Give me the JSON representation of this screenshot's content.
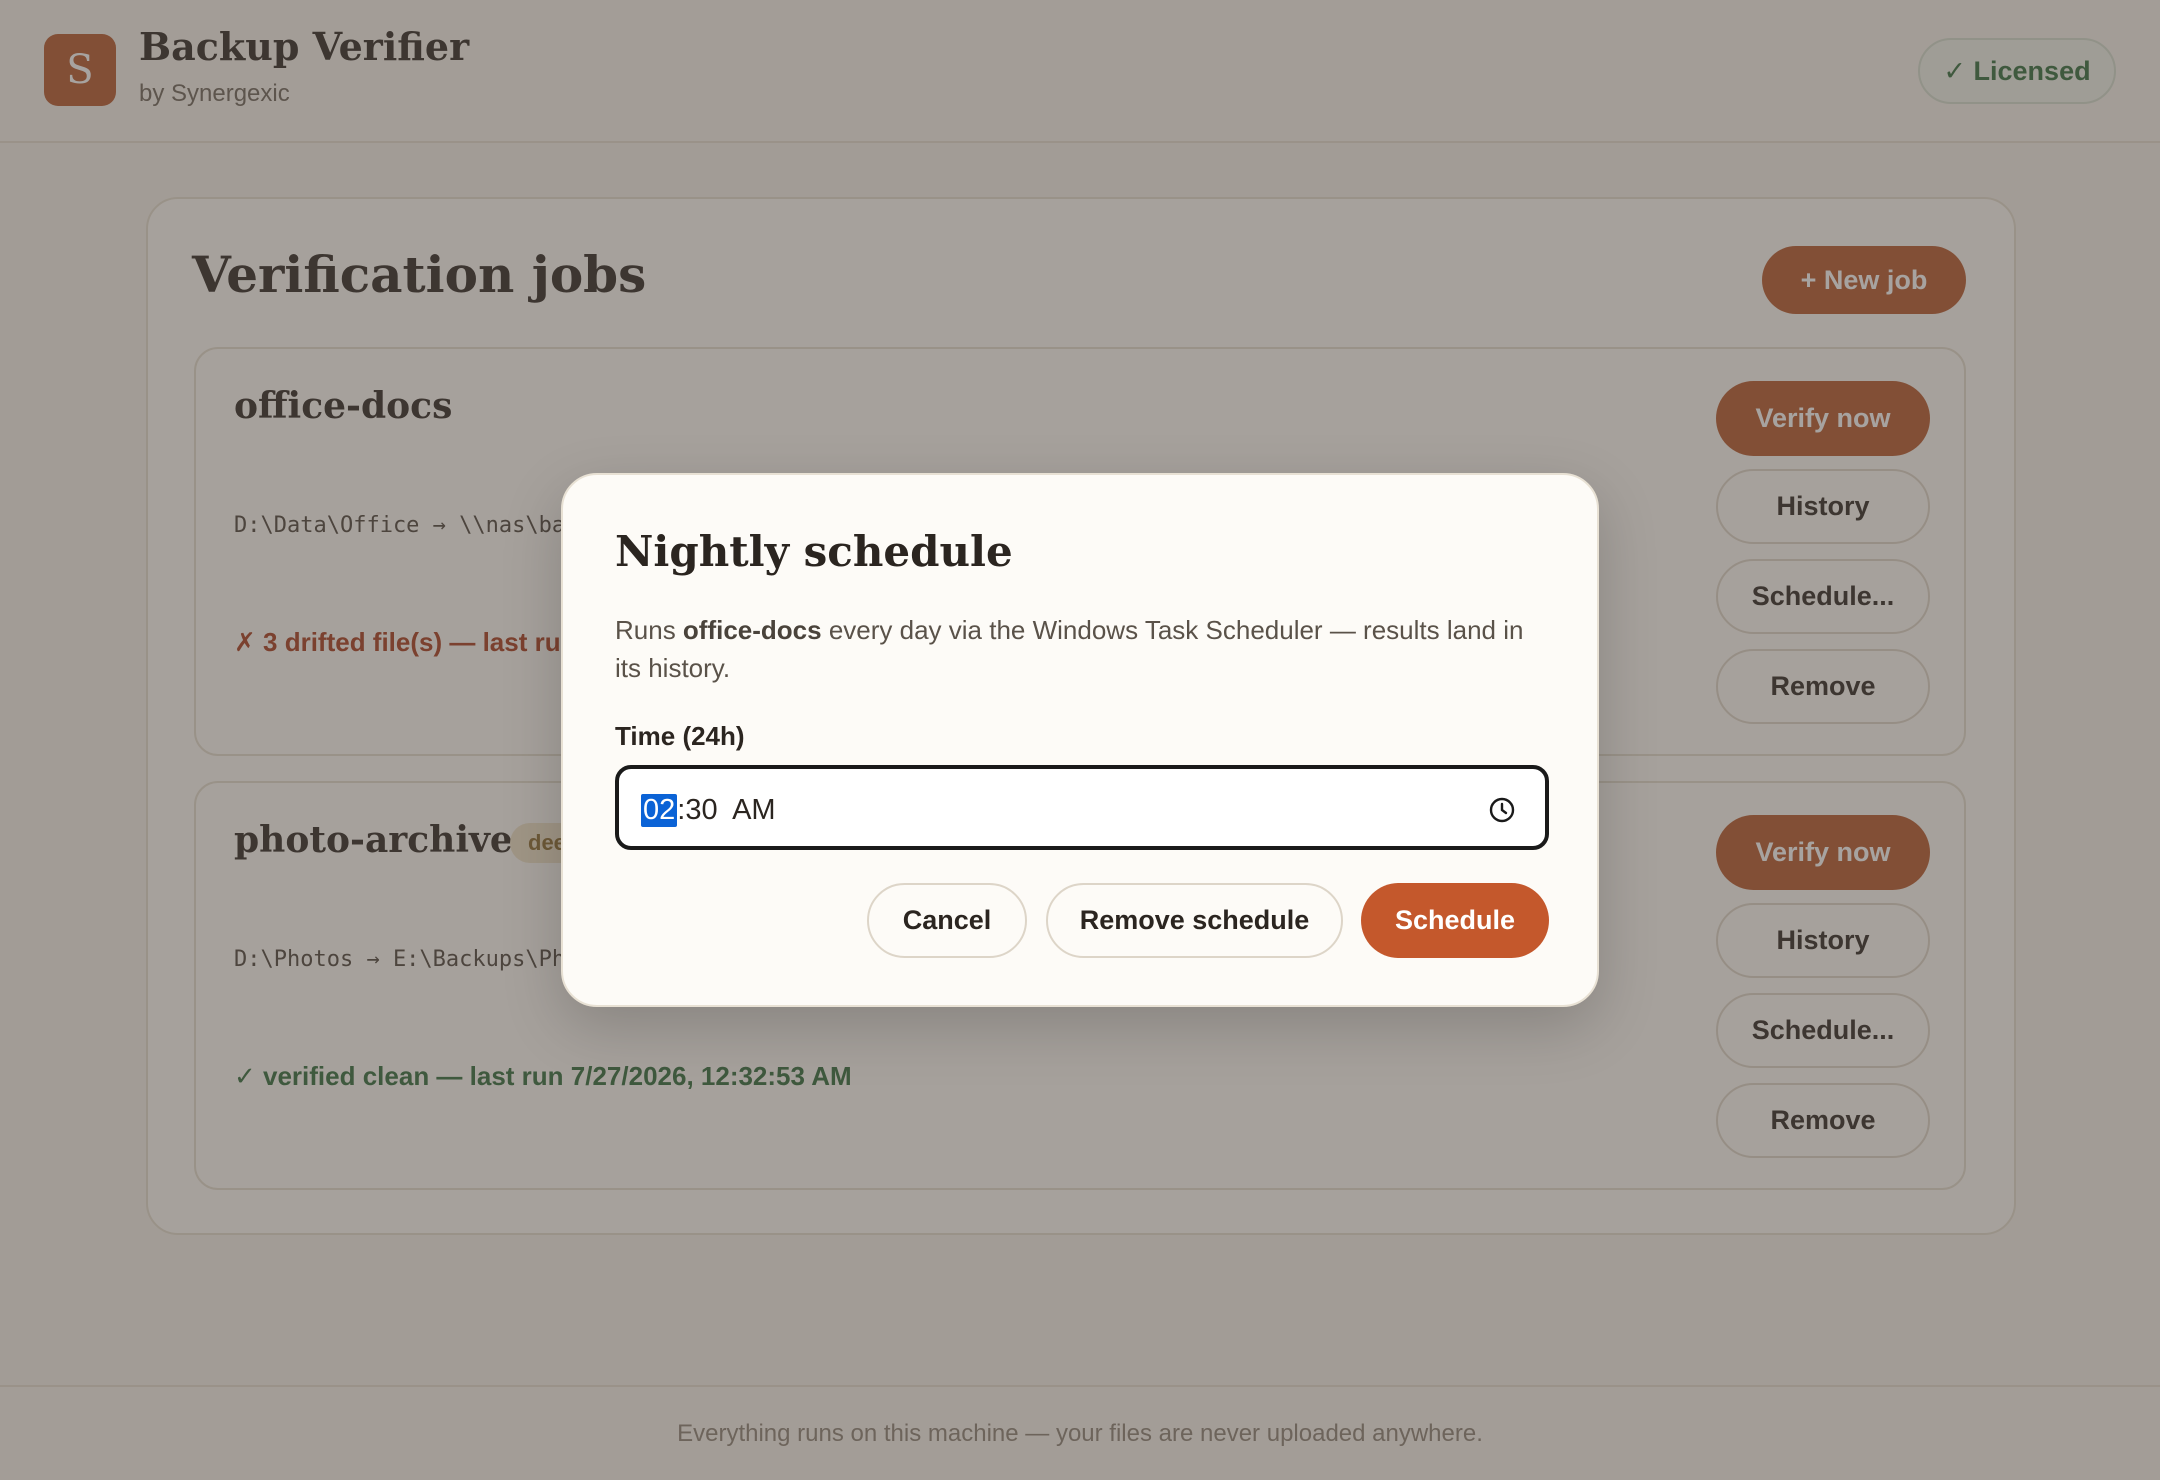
{
  "header": {
    "logo_letter": "S",
    "app_title": "Backup Verifier",
    "app_subtitle": "by Synergexic",
    "license_badge": "✓ Licensed"
  },
  "main": {
    "title": "Verification jobs",
    "new_job_label": "+ New job",
    "jobs": [
      {
        "name": "office-docs",
        "path": "D:\\Data\\Office → \\\\nas\\ba",
        "status": "✗ 3 drifted file(s) — last run",
        "status_kind": "drift",
        "buttons": [
          "Verify now",
          "History",
          "Schedule...",
          "Remove"
        ]
      },
      {
        "name": "photo-archive",
        "tag": "dee",
        "path": "D:\\Photos → E:\\Backups\\Ph",
        "status": "✓ verified clean — last run 7/27/2026, 12:32:53 AM",
        "status_kind": "clean",
        "buttons": [
          "Verify now",
          "History",
          "Schedule...",
          "Remove"
        ]
      }
    ]
  },
  "footer": {
    "text": "Everything runs on this machine — your files are never uploaded anywhere."
  },
  "dialog": {
    "title": "Nightly schedule",
    "desc_prefix": "Runs ",
    "desc_job": "office-docs",
    "desc_suffix": " every day via the Windows Task Scheduler — results land in its history.",
    "time_label": "Time (24h)",
    "time_hour": "02",
    "time_rest": ":30  AM",
    "cancel_label": "Cancel",
    "remove_label": "Remove schedule",
    "schedule_label": "Schedule"
  },
  "colors": {
    "accent": "#b5572b",
    "drift": "#a63a1c",
    "clean": "#2f6a3a",
    "focus_highlight": "#0b63d6"
  }
}
